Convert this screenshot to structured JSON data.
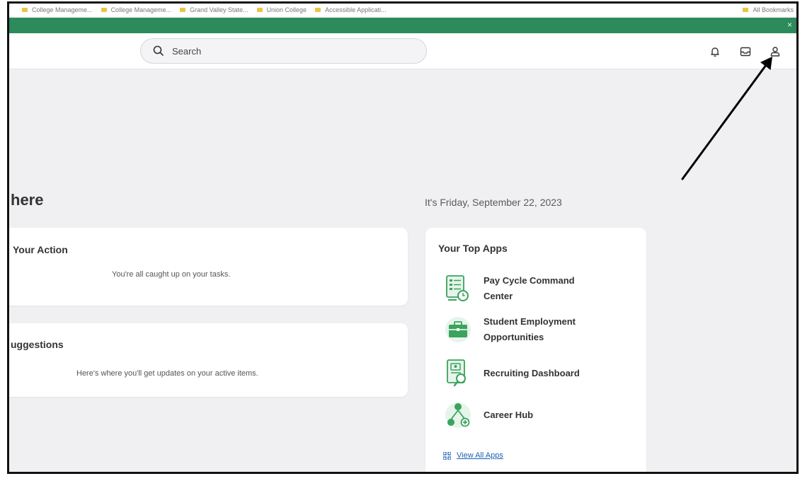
{
  "bookmarks": [
    {
      "label": "College Manageme..."
    },
    {
      "label": "College Manageme..."
    },
    {
      "label": "Grand Valley State..."
    },
    {
      "label": "Union College"
    },
    {
      "label": "Accessible Applicati..."
    }
  ],
  "bookmarks_right": "All Bookmarks",
  "banner": {
    "close_icon": "×"
  },
  "search": {
    "placeholder": "Search"
  },
  "header_icons": [
    "notifications-icon",
    "inbox-icon",
    "profile-icon"
  ],
  "greeting_fragment": "here",
  "date_text": "It's Friday, September 22, 2023",
  "awaiting_card": {
    "title_fragment": "Your Action",
    "message": "You're all caught up on your tasks."
  },
  "suggestions_card": {
    "title_fragment": "uggestions",
    "message": "Here's where you'll get updates on your active items."
  },
  "top_apps": {
    "title": "Your Top Apps",
    "apps": [
      {
        "label": "Pay Cycle Command Center",
        "icon": "pay-cycle-icon"
      },
      {
        "label": "Student Employment Opportunities",
        "icon": "briefcase-icon"
      },
      {
        "label": "Recruiting Dashboard",
        "icon": "recruiting-icon"
      },
      {
        "label": "Career Hub",
        "icon": "career-hub-icon"
      }
    ],
    "view_all": "View All Apps"
  },
  "colors": {
    "banner": "#2d8a5a",
    "app_icon_green": "#3aa35d",
    "link": "#1a5fb4",
    "annotation_arrow": "#000000"
  }
}
